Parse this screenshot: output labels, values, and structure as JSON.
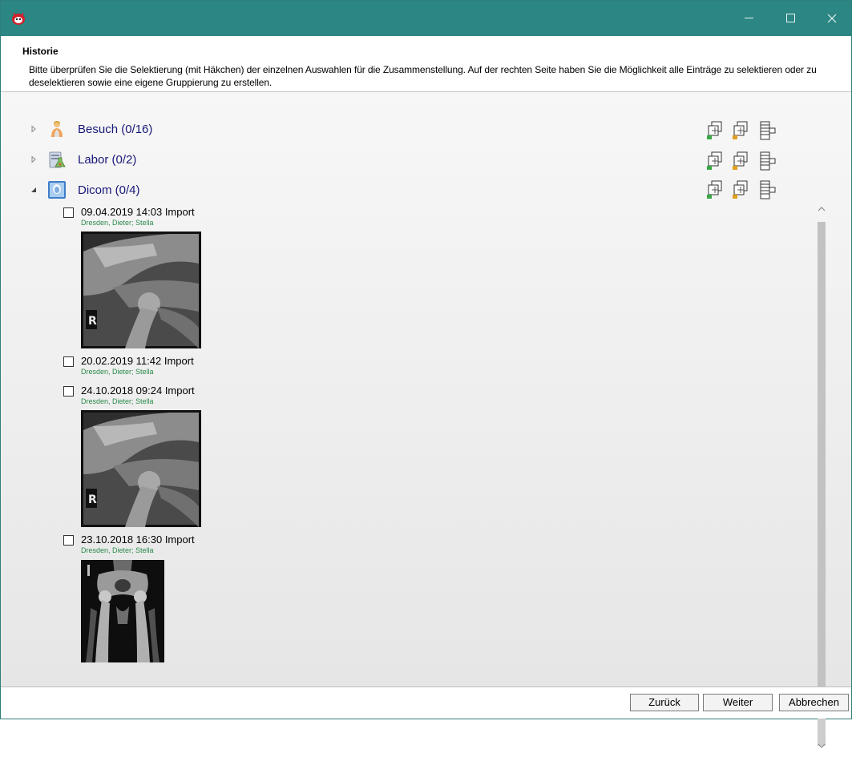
{
  "header": {
    "title": "Historie",
    "description": "Bitte überprüfen Sie die Selektierung (mit Häkchen) der einzelnen Auswahlen für die Zusammenstellung. Auf der rechten Seite haben Sie die Möglichkeit alle Einträge zu selektieren oder zu deselektieren sowie eine eigene Gruppierung zu erstellen."
  },
  "groups": [
    {
      "label": "Besuch  (0/16)",
      "expanded": false,
      "icon": "person-icon"
    },
    {
      "label": "Labor  (0/2)",
      "expanded": false,
      "icon": "lab-icon"
    },
    {
      "label": "Dicom  (0/4)",
      "expanded": true,
      "icon": "dicom-icon"
    }
  ],
  "toolbar_icons": [
    "select-all-icon",
    "deselect-all-icon",
    "grouping-icon"
  ],
  "entries": [
    {
      "title": "09.04.2019 14:03   Import",
      "subtitle": "Dresden, Dieter; Stella",
      "checked": false,
      "thumbnail": "xray-elbow"
    },
    {
      "title": "20.02.2019 11:42   Import",
      "subtitle": "Dresden, Dieter; Stella",
      "checked": false,
      "thumbnail": null
    },
    {
      "title": "24.10.2018 09:24   Import",
      "subtitle": "Dresden, Dieter; Stella",
      "checked": false,
      "thumbnail": "xray-elbow"
    },
    {
      "title": "23.10.2018 16:30   Import",
      "subtitle": "Dresden, Dieter; Stella",
      "checked": false,
      "thumbnail": "xray-hips"
    }
  ],
  "thumbnail_marker": "R",
  "buttons": {
    "back": "Zurück",
    "next": "Weiter",
    "cancel": "Abbrechen"
  },
  "colors": {
    "titlebar": "#2c8683",
    "group_label": "#18187a",
    "subtitle": "#2a8a4a"
  }
}
